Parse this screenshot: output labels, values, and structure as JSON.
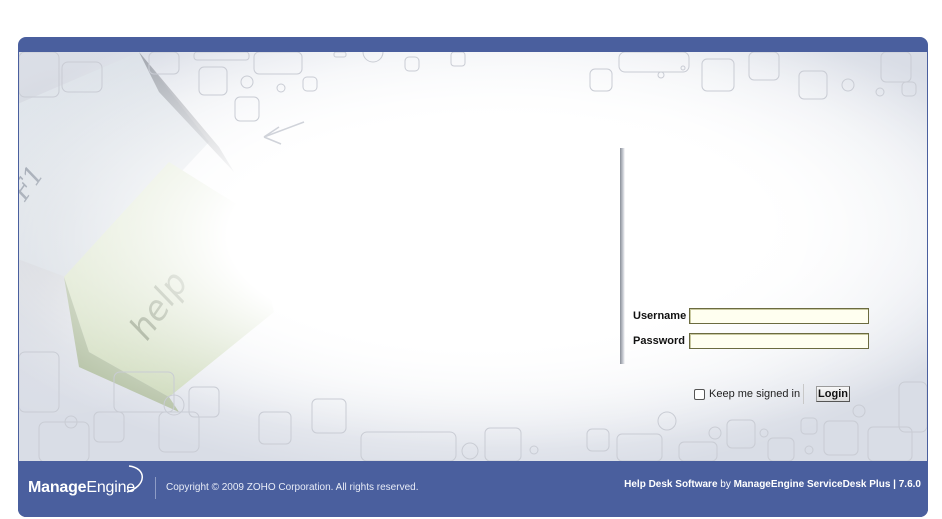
{
  "login": {
    "username_label": "Username",
    "password_label": "Password",
    "username_value": "",
    "password_value": "",
    "keep_signed_in_label": "Keep me signed in",
    "keep_signed_in_checked": false,
    "login_button": "Login"
  },
  "hero": {
    "key_f1_text": "F1",
    "key_help_text": "help"
  },
  "footer": {
    "logo_bold": "Manage",
    "logo_light": "Engine",
    "copyright": "Copyright © 2009 ZOHO Corporation. All rights reserved.",
    "credit_product": "Help Desk Software",
    "credit_by": "by",
    "credit_vendor": "ManageEngine ServiceDesk Plus",
    "credit_pipe": "|",
    "credit_version": "7.6.0"
  },
  "colors": {
    "frame": "#4a5f9e",
    "input_bg": "#fffff0"
  }
}
